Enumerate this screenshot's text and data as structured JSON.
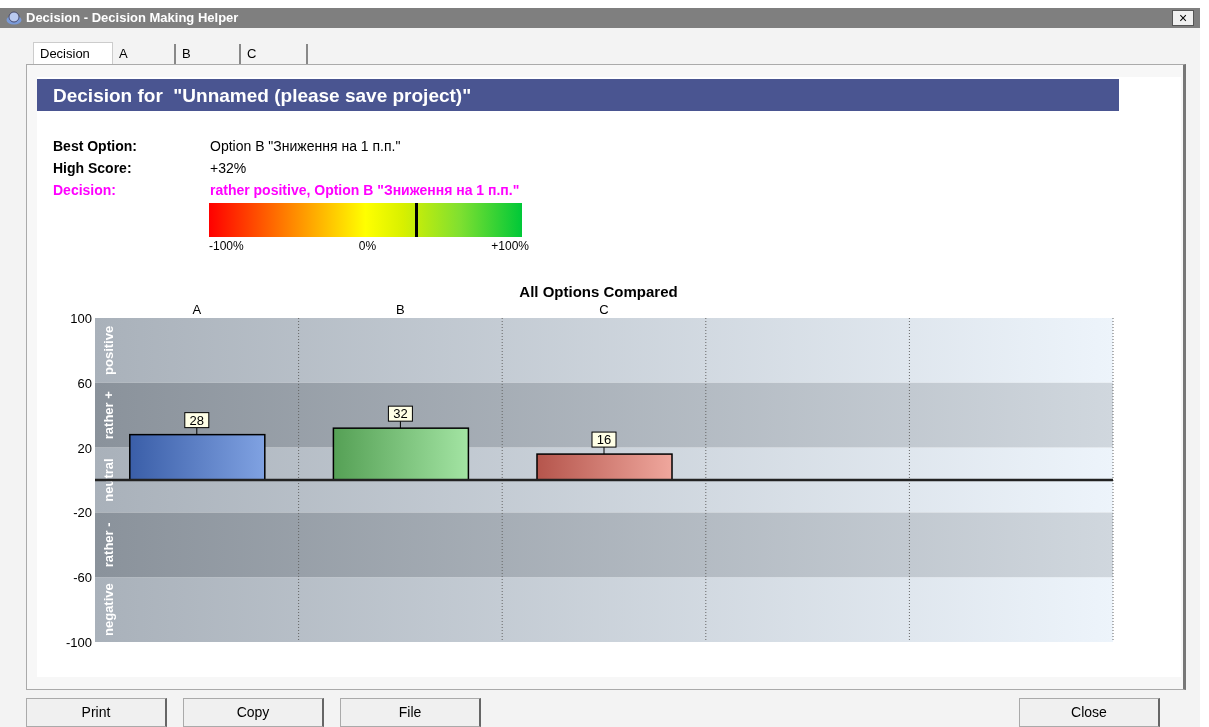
{
  "window": {
    "title": "Decision - Decision Making Helper",
    "close": "×"
  },
  "tabs": [
    {
      "label": "Decision",
      "selected": true
    },
    {
      "label": "A",
      "selected": false
    },
    {
      "label": "B",
      "selected": false
    },
    {
      "label": "C",
      "selected": false
    }
  ],
  "banner": "Decision for  \"Unnamed (please save project)\"",
  "summary": [
    {
      "kind": "plain",
      "label": "Best Option:",
      "value": "Option B \"Зниження на 1 п.п.\""
    },
    {
      "kind": "plain",
      "label": "High Score:",
      "value": "+32%"
    },
    {
      "kind": "highlight",
      "label": "Decision:",
      "value": "rather positive, Option B \"Зниження на 1 п.п.\""
    }
  ],
  "gauge": {
    "level": 0.66,
    "labels": [
      "-100%",
      "0%",
      "+100%"
    ]
  },
  "chart": {
    "chart_data": {
      "type": "bar",
      "title": "All Options Compared",
      "categories": [
        "A",
        "B",
        "C"
      ],
      "values": [
        28,
        32,
        16
      ],
      "ylim": [
        -100,
        100
      ],
      "yticks": [
        -100,
        -60,
        -20,
        20,
        60,
        100
      ],
      "data_labels": true,
      "annotations": [
        {
          "text": "positive"
        },
        {
          "text": "rather +"
        },
        {
          "text": "neutral"
        },
        {
          "text": "rather -"
        },
        {
          "text": "negative"
        }
      ]
    }
  },
  "buttons": [
    {
      "label": "Print",
      "kind": "left"
    },
    {
      "label": "Copy",
      "kind": "left"
    },
    {
      "label": "File",
      "kind": "left"
    },
    {
      "label": "Close",
      "kind": "right"
    }
  ]
}
